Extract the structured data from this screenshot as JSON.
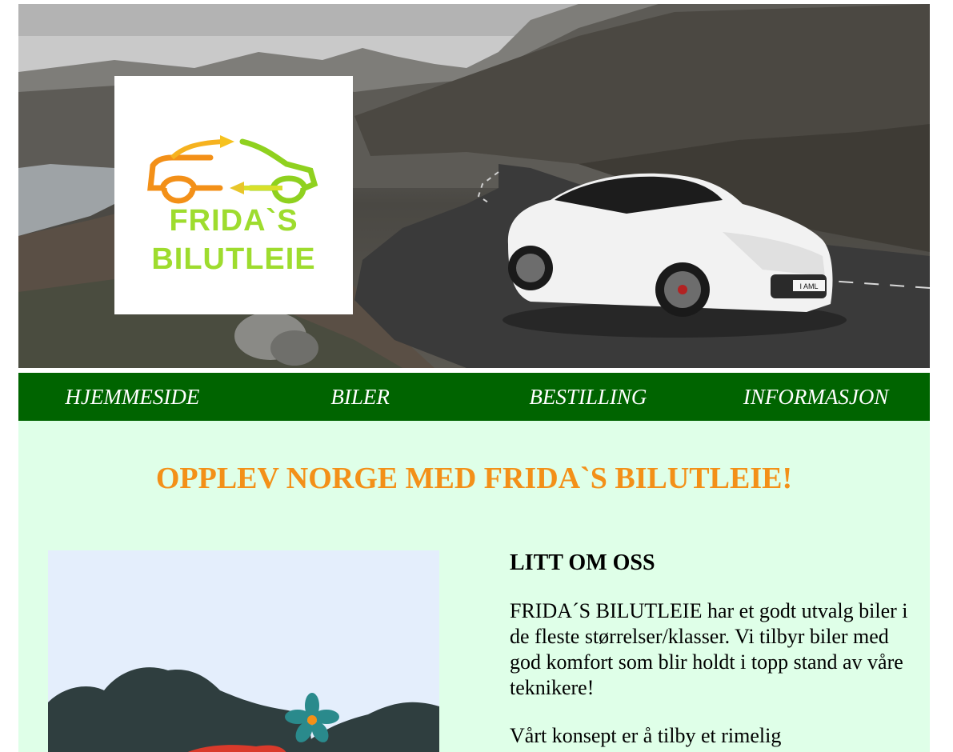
{
  "logo": {
    "line1": "FRIDA`S",
    "line2": "BILUTLEIE"
  },
  "car_plate": "I AML",
  "nav": {
    "items": [
      {
        "label": "HJEMMESIDE"
      },
      {
        "label": "BILER"
      },
      {
        "label": "BESTILLING"
      },
      {
        "label": "INFORMASJON"
      }
    ]
  },
  "main": {
    "headline": "OPPLEV NORGE MED FRIDA`S BILUTLEIE!",
    "about": {
      "title": "LITT OM OSS",
      "paragraph1": "FRIDA´S BILUTLEIE har et godt utvalg biler i de fleste størrelser/klasser. Vi tilbyr biler med god komfort som blir holdt i topp stand av våre teknikere!",
      "paragraph2": "Vårt konsept er å tilby et rimelig"
    }
  },
  "colors": {
    "nav_bg": "#006400",
    "content_bg": "#dfffe8",
    "headline": "#f39018",
    "logo_orange": "#f39018",
    "logo_green": "#8fd11f"
  }
}
